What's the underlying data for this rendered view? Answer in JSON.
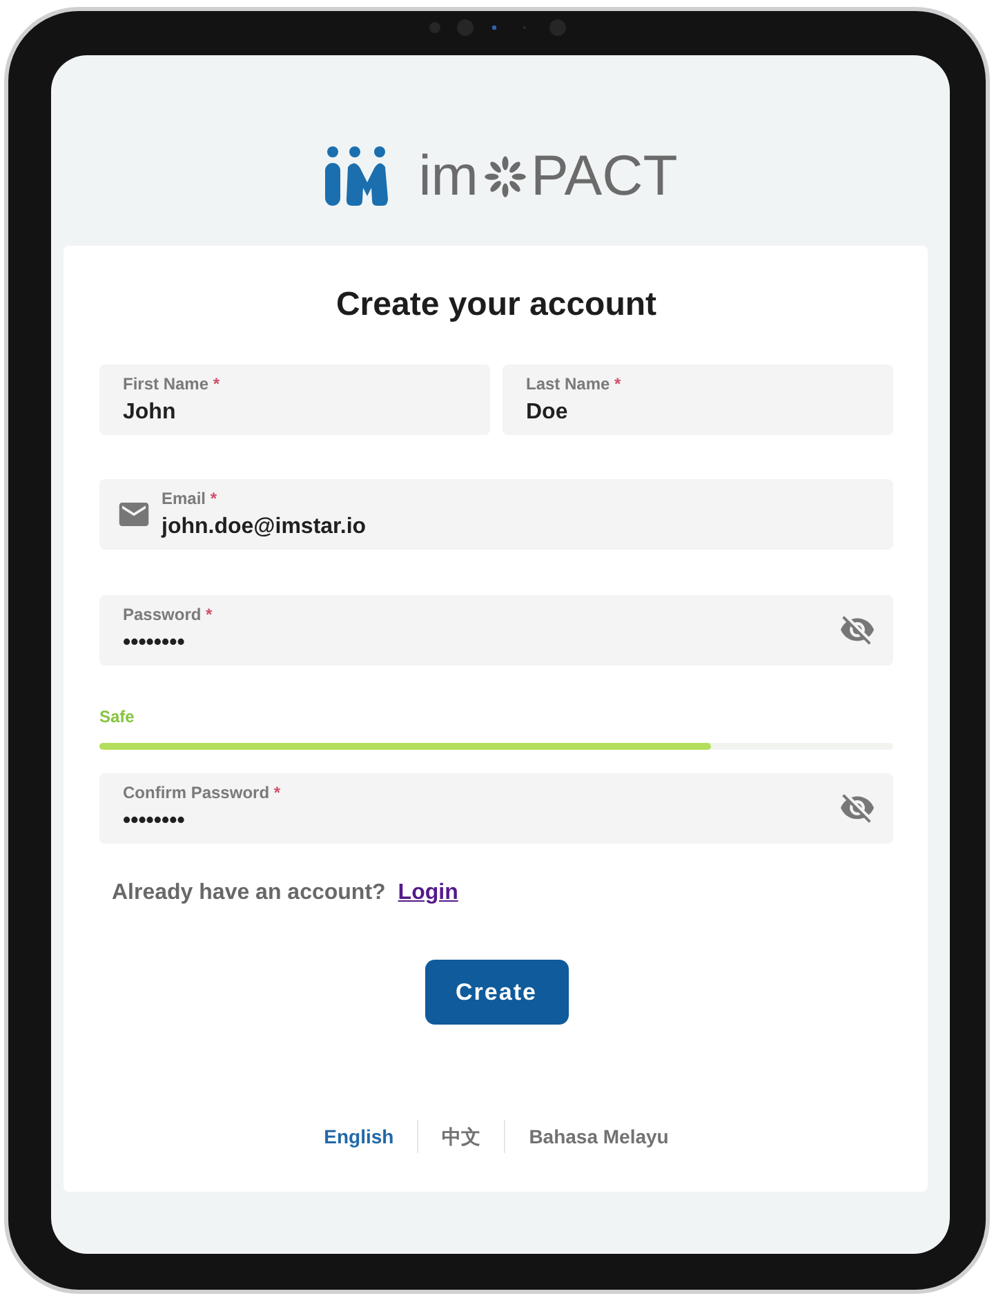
{
  "logo": {
    "name_start": "im",
    "name_end": "PACT"
  },
  "title": "Create your account",
  "name_fields": [
    {
      "kind": "text",
      "label": "First Name",
      "required_mark": "*",
      "value": "John"
    },
    {
      "kind": "text",
      "label": "Last Name",
      "required_mark": "*",
      "value": "Doe"
    }
  ],
  "email_field": {
    "kind": "email",
    "label": "Email",
    "required_mark": "*",
    "value": "john.doe@imstar.io"
  },
  "password_field": {
    "kind": "password",
    "label": "Password",
    "required_mark": "*",
    "value": "••••••••"
  },
  "strength": {
    "label": "Safe",
    "level": 0.77
  },
  "confirm_password_field": {
    "kind": "password",
    "label": "Confirm Password",
    "required_mark": "*",
    "value": "••••••••"
  },
  "login_prompt": {
    "text": "Already have an account?",
    "link": "Login"
  },
  "submit_button": "Create",
  "languages": [
    {
      "label": "English",
      "selected": true
    },
    {
      "label": "中文",
      "selected": false
    },
    {
      "label": "Bahasa Melayu",
      "selected": false
    }
  ]
}
